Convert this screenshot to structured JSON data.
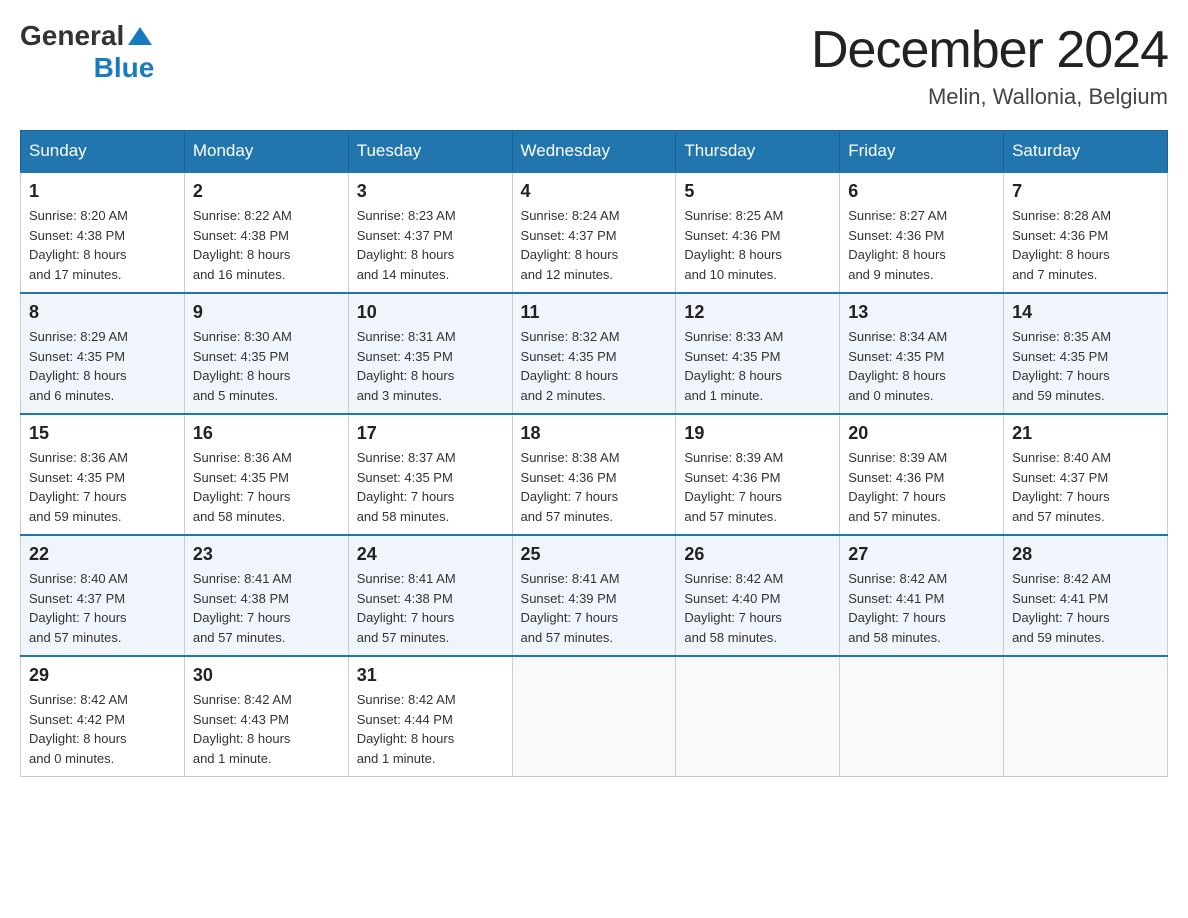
{
  "header": {
    "logo": {
      "general": "General",
      "blue": "Blue",
      "aria": "GeneralBlue logo"
    },
    "title": "December 2024",
    "location": "Melin, Wallonia, Belgium"
  },
  "days_of_week": [
    "Sunday",
    "Monday",
    "Tuesday",
    "Wednesday",
    "Thursday",
    "Friday",
    "Saturday"
  ],
  "weeks": [
    [
      {
        "day": 1,
        "sunrise": "8:20 AM",
        "sunset": "4:38 PM",
        "daylight": "8 hours and 17 minutes."
      },
      {
        "day": 2,
        "sunrise": "8:22 AM",
        "sunset": "4:38 PM",
        "daylight": "8 hours and 16 minutes."
      },
      {
        "day": 3,
        "sunrise": "8:23 AM",
        "sunset": "4:37 PM",
        "daylight": "8 hours and 14 minutes."
      },
      {
        "day": 4,
        "sunrise": "8:24 AM",
        "sunset": "4:37 PM",
        "daylight": "8 hours and 12 minutes."
      },
      {
        "day": 5,
        "sunrise": "8:25 AM",
        "sunset": "4:36 PM",
        "daylight": "8 hours and 10 minutes."
      },
      {
        "day": 6,
        "sunrise": "8:27 AM",
        "sunset": "4:36 PM",
        "daylight": "8 hours and 9 minutes."
      },
      {
        "day": 7,
        "sunrise": "8:28 AM",
        "sunset": "4:36 PM",
        "daylight": "8 hours and 7 minutes."
      }
    ],
    [
      {
        "day": 8,
        "sunrise": "8:29 AM",
        "sunset": "4:35 PM",
        "daylight": "8 hours and 6 minutes."
      },
      {
        "day": 9,
        "sunrise": "8:30 AM",
        "sunset": "4:35 PM",
        "daylight": "8 hours and 5 minutes."
      },
      {
        "day": 10,
        "sunrise": "8:31 AM",
        "sunset": "4:35 PM",
        "daylight": "8 hours and 3 minutes."
      },
      {
        "day": 11,
        "sunrise": "8:32 AM",
        "sunset": "4:35 PM",
        "daylight": "8 hours and 2 minutes."
      },
      {
        "day": 12,
        "sunrise": "8:33 AM",
        "sunset": "4:35 PM",
        "daylight": "8 hours and 1 minute."
      },
      {
        "day": 13,
        "sunrise": "8:34 AM",
        "sunset": "4:35 PM",
        "daylight": "8 hours and 0 minutes."
      },
      {
        "day": 14,
        "sunrise": "8:35 AM",
        "sunset": "4:35 PM",
        "daylight": "7 hours and 59 minutes."
      }
    ],
    [
      {
        "day": 15,
        "sunrise": "8:36 AM",
        "sunset": "4:35 PM",
        "daylight": "7 hours and 59 minutes."
      },
      {
        "day": 16,
        "sunrise": "8:36 AM",
        "sunset": "4:35 PM",
        "daylight": "7 hours and 58 minutes."
      },
      {
        "day": 17,
        "sunrise": "8:37 AM",
        "sunset": "4:35 PM",
        "daylight": "7 hours and 58 minutes."
      },
      {
        "day": 18,
        "sunrise": "8:38 AM",
        "sunset": "4:36 PM",
        "daylight": "7 hours and 57 minutes."
      },
      {
        "day": 19,
        "sunrise": "8:39 AM",
        "sunset": "4:36 PM",
        "daylight": "7 hours and 57 minutes."
      },
      {
        "day": 20,
        "sunrise": "8:39 AM",
        "sunset": "4:36 PM",
        "daylight": "7 hours and 57 minutes."
      },
      {
        "day": 21,
        "sunrise": "8:40 AM",
        "sunset": "4:37 PM",
        "daylight": "7 hours and 57 minutes."
      }
    ],
    [
      {
        "day": 22,
        "sunrise": "8:40 AM",
        "sunset": "4:37 PM",
        "daylight": "7 hours and 57 minutes."
      },
      {
        "day": 23,
        "sunrise": "8:41 AM",
        "sunset": "4:38 PM",
        "daylight": "7 hours and 57 minutes."
      },
      {
        "day": 24,
        "sunrise": "8:41 AM",
        "sunset": "4:38 PM",
        "daylight": "7 hours and 57 minutes."
      },
      {
        "day": 25,
        "sunrise": "8:41 AM",
        "sunset": "4:39 PM",
        "daylight": "7 hours and 57 minutes."
      },
      {
        "day": 26,
        "sunrise": "8:42 AM",
        "sunset": "4:40 PM",
        "daylight": "7 hours and 58 minutes."
      },
      {
        "day": 27,
        "sunrise": "8:42 AM",
        "sunset": "4:41 PM",
        "daylight": "7 hours and 58 minutes."
      },
      {
        "day": 28,
        "sunrise": "8:42 AM",
        "sunset": "4:41 PM",
        "daylight": "7 hours and 59 minutes."
      }
    ],
    [
      {
        "day": 29,
        "sunrise": "8:42 AM",
        "sunset": "4:42 PM",
        "daylight": "8 hours and 0 minutes."
      },
      {
        "day": 30,
        "sunrise": "8:42 AM",
        "sunset": "4:43 PM",
        "daylight": "8 hours and 1 minute."
      },
      {
        "day": 31,
        "sunrise": "8:42 AM",
        "sunset": "4:44 PM",
        "daylight": "8 hours and 1 minute."
      },
      null,
      null,
      null,
      null
    ]
  ],
  "labels": {
    "sunrise": "Sunrise:",
    "sunset": "Sunset:",
    "daylight": "Daylight:"
  }
}
